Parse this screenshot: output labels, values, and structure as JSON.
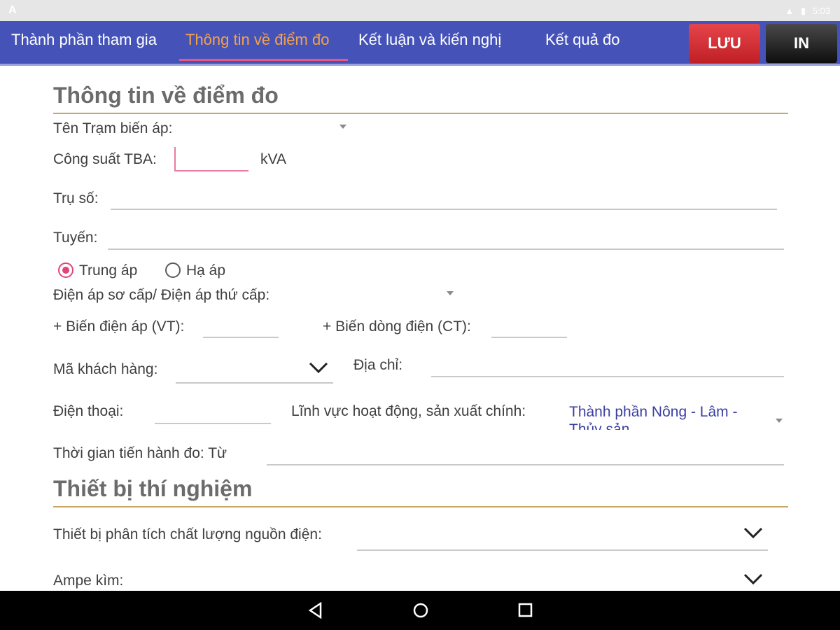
{
  "statusbar": {
    "left_icon": "A",
    "right_icons": [
      "signal-icon",
      "battery-icon"
    ],
    "time": "5:03"
  },
  "tabs": [
    {
      "label": "Thành phần tham gia",
      "active": false
    },
    {
      "label": "Thông tin về điểm đo",
      "active": true
    },
    {
      "label": "Kết luận và kiến nghị",
      "active": false
    },
    {
      "label": "Kết quả đo",
      "active": false
    }
  ],
  "actions": {
    "save_label": "LƯU",
    "print_label": "IN"
  },
  "section1": {
    "title": "Thông tin về điểm đo",
    "station_label": "Tên Trạm biến áp:",
    "capacity_label": "Công suất TBA:",
    "capacity_unit": "kVA",
    "pole_label": "Trụ số:",
    "line_label": "Tuyến:",
    "voltage_type": {
      "options": [
        "Trung áp",
        "Hạ áp"
      ],
      "selected": "Trung áp"
    },
    "voltage_label": "Điện áp sơ cấp/ Điện áp thứ cấp:",
    "vt_label": "+ Biến điện áp (VT):",
    "ct_label": "+ Biến dòng điện (CT):",
    "customer_label": "Mã khách hàng:",
    "address_label": "Địa chỉ:",
    "phone_label": "Điện thoại:",
    "sector_label": "Lĩnh vực hoạt động, sản xuất chính:",
    "sector_value": "Thành phần Nông - Lâm - Thủy sản",
    "time_label": "Thời gian tiến hành đo: Từ"
  },
  "section2": {
    "title": "Thiết bị thí nghiệm",
    "analyzer_label": "Thiết bị phân tích chất lượng nguồn điện:",
    "ammeter_label": "Ampe kìm:"
  },
  "colors": {
    "tabbar": "#4553b8",
    "active_tab": "#f4a14a",
    "accent": "#e0457a",
    "save": "#d32f2f",
    "rule": "#c9a867"
  }
}
